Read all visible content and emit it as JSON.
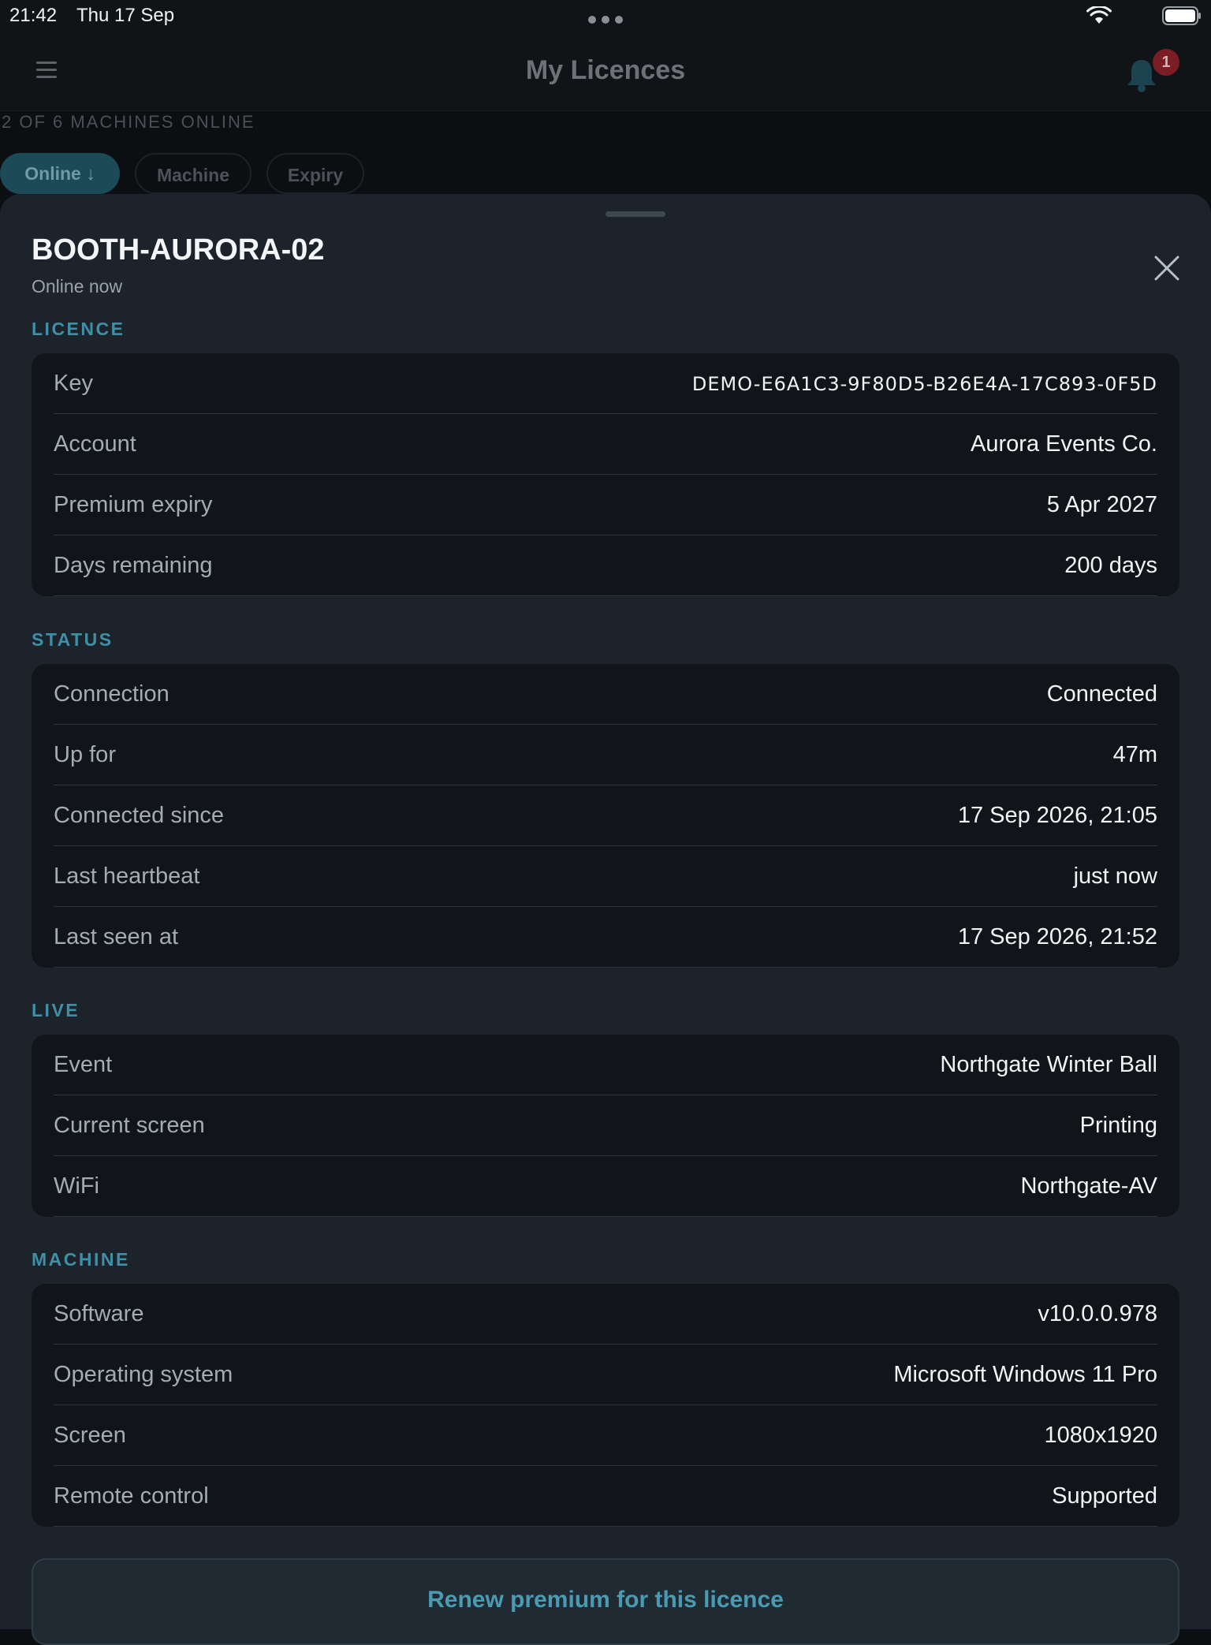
{
  "status_bar": {
    "time": "21:42",
    "date": "Thu 17 Sep"
  },
  "header": {
    "title": "My Licences",
    "notification_count": "1"
  },
  "list": {
    "machines_online": "2 OF 6 MACHINES ONLINE",
    "sort_chips": [
      "Online ↓",
      "Machine",
      "Expiry"
    ]
  },
  "sheet": {
    "title": "BOOTH-AURORA-02",
    "subtitle": "Online now",
    "sections": {
      "licence": {
        "label": "LICENCE",
        "rows": [
          {
            "label": "Key",
            "value": "DEMO-E6A1C3-9F80D5-B26E4A-17C893-0F5D"
          },
          {
            "label": "Account",
            "value": "Aurora Events Co."
          },
          {
            "label": "Premium expiry",
            "value": "5 Apr 2027"
          },
          {
            "label": "Days remaining",
            "value": "200 days"
          }
        ]
      },
      "status": {
        "label": "STATUS",
        "rows": [
          {
            "label": "Connection",
            "value": "Connected"
          },
          {
            "label": "Up for",
            "value": "47m"
          },
          {
            "label": "Connected since",
            "value": "17 Sep 2026, 21:05"
          },
          {
            "label": "Last heartbeat",
            "value": "just now"
          },
          {
            "label": "Last seen at",
            "value": "17 Sep 2026, 21:52"
          }
        ]
      },
      "live": {
        "label": "LIVE",
        "rows": [
          {
            "label": "Event",
            "value": "Northgate Winter Ball"
          },
          {
            "label": "Current screen",
            "value": "Printing"
          },
          {
            "label": "WiFi",
            "value": "Northgate-AV"
          }
        ]
      },
      "machine": {
        "label": "MACHINE",
        "rows": [
          {
            "label": "Software",
            "value": "v10.0.0.978"
          },
          {
            "label": "Operating system",
            "value": "Microsoft Windows 11 Pro"
          },
          {
            "label": "Screen",
            "value": "1080x1920"
          },
          {
            "label": "Remote control",
            "value": "Supported"
          }
        ]
      }
    },
    "renew_button_label": "Renew premium for this licence"
  },
  "colors": {
    "accent": "#3f8fa6",
    "sheet_background": "#1c232a",
    "card_background": "#111519",
    "badge": "#7a1d25"
  },
  "icons": [
    "menu-icon",
    "bell-icon",
    "close-icon",
    "wifi-icon",
    "battery-icon",
    "multitasking-dots-icon"
  ]
}
